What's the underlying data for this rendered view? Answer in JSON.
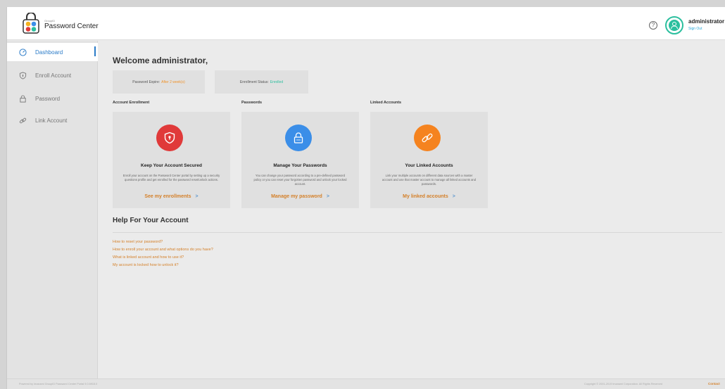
{
  "header": {
    "brand_small": "GroupID",
    "brand_name": "Password Center",
    "help_icon": "question-circle-icon",
    "user_name": "administrator",
    "sign_out": "Sign Out"
  },
  "sidebar": {
    "items": [
      {
        "label": "Dashboard",
        "icon": "gauge-icon",
        "active": true
      },
      {
        "label": "Enroll Account",
        "icon": "shield-icon",
        "active": false
      },
      {
        "label": "Password",
        "icon": "lock-icon",
        "active": false
      },
      {
        "label": "Link Account",
        "icon": "link-icon",
        "active": false
      }
    ]
  },
  "main": {
    "welcome": "Welcome administrator,",
    "status": {
      "password_expire_label": "Password Expire:",
      "password_expire_value": "After 2 week(s)",
      "enrollment_label": "Enrollment Status:",
      "enrollment_value": "Enrolled"
    },
    "sections": {
      "enrollment": "Account Enrollment",
      "passwords": "Passwords",
      "linked": "Linked Accounts"
    },
    "cards": [
      {
        "title": "Keep Your Account Secured",
        "desc": "Enroll your account on the Password Center portal by setting up a security questions profile and get enrolled for the password reset/unlock actions.",
        "link": "See my enrollments",
        "icon": "shield-icon",
        "color": "#e03a3a"
      },
      {
        "title": "Manage Your Passwords",
        "desc": "You can change your password according to a pre-defined password policy or you can reset your forgotten password and unlock your locked account.",
        "link": "Manage my password",
        "icon": "lock-icon",
        "color": "#3b8ee8"
      },
      {
        "title": "Your Linked Accounts",
        "desc": "Link your multiple accounts on different data sources with a master account and use that master account to manage all linked accounts and passwords.",
        "link": "My linked accounts",
        "icon": "link-icon",
        "color": "#f5831f"
      }
    ],
    "link_arrow": ">",
    "help_title": "Help For Your Account",
    "help_links": [
      "How to reset your password?",
      "How to enroll your account and what options do you have?",
      "What is linked account and how to use it?",
      "My account is locked how to unlock it?"
    ]
  },
  "footer": {
    "left": "Powered by Imanami GroupID Password Center Portal 9.0.6915.0",
    "right": "Copyright © 2001-2019 Imanami Corporation. All Rights Reserved",
    "contact": "Contact"
  },
  "colors": {
    "accent": "#2a7bc8",
    "link": "#d4802a",
    "teal": "#2bbf9e",
    "orange": "#f0932b"
  }
}
